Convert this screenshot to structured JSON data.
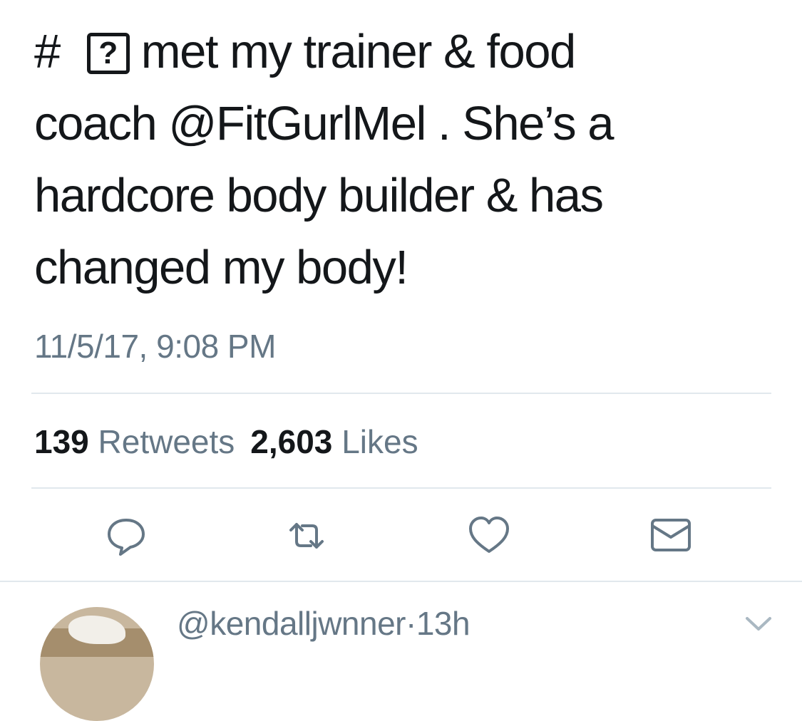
{
  "tweet": {
    "hash": "#",
    "placeholder_glyph": "?",
    "line1_rest": "met my trainer & food",
    "line2": "coach @FitGurlMel . She’s a",
    "line3": "hardcore body builder & has",
    "line4": "changed my body!",
    "timestamp": "11/5/17, 9:08 PM"
  },
  "stats": {
    "retweets_count": "139",
    "retweets_label": "Retweets",
    "likes_count": "2,603",
    "likes_label": "Likes"
  },
  "actions": {
    "icons": [
      "reply-icon",
      "retweet-icon",
      "like-icon",
      "direct-message-icon"
    ]
  },
  "reply": {
    "handle": "@kendalljwnner",
    "separator": "·",
    "age": "13h"
  },
  "colors": {
    "text": "#14171a",
    "secondary": "#657786",
    "divider": "#e1e8ed",
    "icon": "#657786"
  }
}
